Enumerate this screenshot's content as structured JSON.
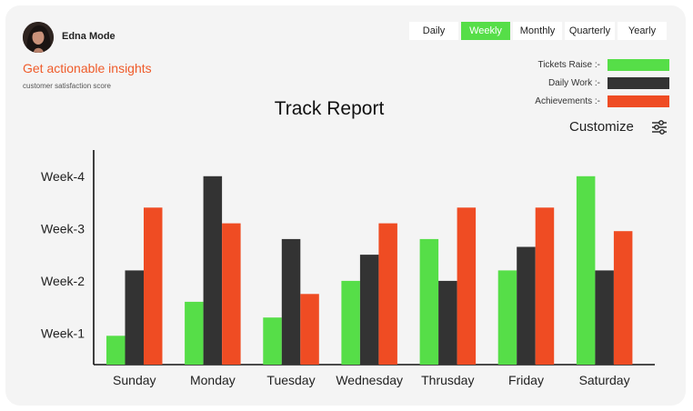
{
  "user": {
    "name": "Edna Mode"
  },
  "header": {
    "headline": "Get actionable insights",
    "subline": "customer satisfaction score"
  },
  "period_tabs": [
    {
      "label": "Daily",
      "active": false
    },
    {
      "label": "Weekly",
      "active": true
    },
    {
      "label": "Monthly",
      "active": false
    },
    {
      "label": "Quarterly",
      "active": false
    },
    {
      "label": "Yearly",
      "active": false
    }
  ],
  "legend": [
    {
      "label": "Tickets Raise :-",
      "color": "#56de48"
    },
    {
      "label": "Daily Work :-",
      "color": "#333333"
    },
    {
      "label": "Achievements :-",
      "color": "#ef4c23"
    }
  ],
  "customize": {
    "label": "Customize",
    "icon": "sliders-icon"
  },
  "chart_data": {
    "type": "bar",
    "title": "Track Report",
    "categories": [
      "Sunday",
      "Monday",
      "Tuesday",
      "Wednesday",
      "Thrusday",
      "Friday",
      "Saturday"
    ],
    "y_tick_labels": [
      "Week-1",
      "Week-2",
      "Week-3",
      "Week-4"
    ],
    "y_tick_values": [
      1,
      2,
      3,
      4
    ],
    "ylim": [
      0.4,
      4.5
    ],
    "grid": false,
    "legend_position": "top-right",
    "series": [
      {
        "name": "Tickets Raise",
        "color": "#56de48",
        "values": [
          0.95,
          1.6,
          1.3,
          2.0,
          2.8,
          2.2,
          4.0
        ]
      },
      {
        "name": "Daily Work",
        "color": "#333333",
        "values": [
          2.2,
          4.0,
          2.8,
          2.5,
          2.0,
          2.65,
          2.2
        ]
      },
      {
        "name": "Achievements",
        "color": "#ef4c23",
        "values": [
          3.4,
          3.1,
          1.75,
          3.1,
          3.4,
          3.4,
          2.95
        ]
      }
    ]
  }
}
